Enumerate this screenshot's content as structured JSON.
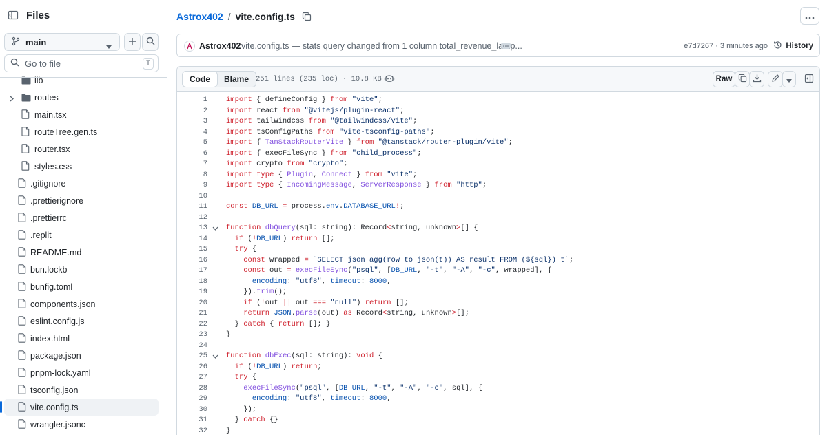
{
  "sidebar": {
    "title": "Files",
    "branch": "main",
    "goto_placeholder": "Go to file",
    "goto_key": "T",
    "tree": [
      {
        "name": "lib",
        "type": "folder",
        "expandable": false,
        "depth": 1
      },
      {
        "name": "routes",
        "type": "folder",
        "expandable": true,
        "depth": 1
      },
      {
        "name": "main.tsx",
        "type": "file",
        "depth": 1
      },
      {
        "name": "routeTree.gen.ts",
        "type": "file",
        "depth": 1
      },
      {
        "name": "router.tsx",
        "type": "file",
        "depth": 1
      },
      {
        "name": "styles.css",
        "type": "file",
        "depth": 1
      },
      {
        "name": ".gitignore",
        "type": "file",
        "depth": 0
      },
      {
        "name": ".prettierignore",
        "type": "file",
        "depth": 0
      },
      {
        "name": ".prettierrc",
        "type": "file",
        "depth": 0
      },
      {
        "name": ".replit",
        "type": "file",
        "depth": 0
      },
      {
        "name": "README.md",
        "type": "file",
        "depth": 0
      },
      {
        "name": "bun.lockb",
        "type": "file",
        "depth": 0
      },
      {
        "name": "bunfig.toml",
        "type": "file",
        "depth": 0
      },
      {
        "name": "components.json",
        "type": "file",
        "depth": 0
      },
      {
        "name": "eslint.config.js",
        "type": "file",
        "depth": 0
      },
      {
        "name": "index.html",
        "type": "file",
        "depth": 0
      },
      {
        "name": "package.json",
        "type": "file",
        "depth": 0
      },
      {
        "name": "pnpm-lock.yaml",
        "type": "file",
        "depth": 0
      },
      {
        "name": "tsconfig.json",
        "type": "file",
        "depth": 0
      },
      {
        "name": "vite.config.ts",
        "type": "file",
        "depth": 0,
        "active": true
      },
      {
        "name": "wrangler.jsonc",
        "type": "file",
        "depth": 0
      }
    ]
  },
  "header": {
    "repo": "Astrox402",
    "separator": "/",
    "file": "vite.config.ts"
  },
  "commit": {
    "author": "Astrox402",
    "message": "vite.config.ts — stats query changed from 1 column total_revenue_lamp...",
    "sha": "e7d7267",
    "time": "3 minutes ago",
    "history_label": "History"
  },
  "file": {
    "tab_code": "Code",
    "tab_blame": "Blame",
    "info": "251 lines (235 loc) · 10.8 KB",
    "raw_label": "Raw"
  },
  "code_lines": [
    {
      "n": "1",
      "fold": false,
      "html": "<span class='kw'>import</span> { defineConfig } <span class='kw'>from</span> <span class='st'>\"vite\"</span>;"
    },
    {
      "n": "2",
      "fold": false,
      "html": "<span class='kw'>import</span> react <span class='kw'>from</span> <span class='st'>\"@vitejs/plugin-react\"</span>;"
    },
    {
      "n": "3",
      "fold": false,
      "html": "<span class='kw'>import</span> tailwindcss <span class='kw'>from</span> <span class='st'>\"@tailwindcss/vite\"</span>;"
    },
    {
      "n": "4",
      "fold": false,
      "html": "<span class='kw'>import</span> tsConfigPaths <span class='kw'>from</span> <span class='st'>\"vite-tsconfig-paths\"</span>;"
    },
    {
      "n": "5",
      "fold": false,
      "html": "<span class='kw'>import</span> { <span class='fn'>TanStackRouterVite</span> } <span class='kw'>from</span> <span class='st'>\"@tanstack/router-plugin/vite\"</span>;"
    },
    {
      "n": "6",
      "fold": false,
      "html": "<span class='kw'>import</span> { execFileSync } <span class='kw'>from</span> <span class='st'>\"child_process\"</span>;"
    },
    {
      "n": "7",
      "fold": false,
      "html": "<span class='kw'>import</span> crypto <span class='kw'>from</span> <span class='st'>\"crypto\"</span>;"
    },
    {
      "n": "8",
      "fold": false,
      "html": "<span class='kw'>import</span> <span class='kw'>type</span> { <span class='fn'>Plugin</span>, <span class='fn'>Connect</span> } <span class='kw'>from</span> <span class='st'>\"vite\"</span>;"
    },
    {
      "n": "9",
      "fold": false,
      "html": "<span class='kw'>import</span> <span class='kw'>type</span> { <span class='fn'>IncomingMessage</span>, <span class='fn'>ServerResponse</span> } <span class='kw'>from</span> <span class='st'>\"http\"</span>;"
    },
    {
      "n": "10",
      "fold": false,
      "html": ""
    },
    {
      "n": "11",
      "fold": false,
      "html": "<span class='kw'>const</span> <span class='id'>DB_URL</span> <span class='kw'>=</span> process.<span class='id'>env</span>.<span class='id'>DATABASE_URL</span><span class='kw'>!</span>;"
    },
    {
      "n": "12",
      "fold": false,
      "html": ""
    },
    {
      "n": "13",
      "fold": true,
      "html": "<span class='kw'>function</span> <span class='fn'>dbQuery</span>(sql: string): Record<span class='kw'>&lt;</span>string, unknown<span class='kw'>&gt;</span>[] {"
    },
    {
      "n": "14",
      "fold": false,
      "html": "  <span class='kw'>if</span> (<span class='kw'>!</span><span class='id'>DB_URL</span>) <span class='kw'>return</span> [];"
    },
    {
      "n": "15",
      "fold": false,
      "html": "  <span class='kw'>try</span> {"
    },
    {
      "n": "16",
      "fold": false,
      "html": "    <span class='kw'>const</span> wrapped <span class='kw'>=</span> <span class='st'>`SELECT json_agg(row_to_json(t)) AS result FROM (${sql}) t`</span>;"
    },
    {
      "n": "17",
      "fold": false,
      "html": "    <span class='kw'>const</span> out <span class='kw'>=</span> <span class='fn'>execFileSync</span>(<span class='st'>\"psql\"</span>, [<span class='id'>DB_URL</span>, <span class='st'>\"-t\"</span>, <span class='st'>\"-A\"</span>, <span class='st'>\"-c\"</span>, wrapped], {"
    },
    {
      "n": "18",
      "fold": false,
      "html": "      <span class='id'>encoding</span>: <span class='st'>\"utf8\"</span>, <span class='id'>timeout</span>: <span class='id'>8000</span>,"
    },
    {
      "n": "19",
      "fold": false,
      "html": "    }).<span class='fn'>trim</span>();"
    },
    {
      "n": "20",
      "fold": false,
      "html": "    <span class='kw'>if</span> (<span class='kw'>!</span>out <span class='kw'>||</span> out <span class='kw'>===</span> <span class='st'>\"null\"</span>) <span class='kw'>return</span> [];"
    },
    {
      "n": "21",
      "fold": false,
      "html": "    <span class='kw'>return</span> <span class='id'>JSON</span>.<span class='fn'>parse</span>(out) <span class='kw'>as</span> Record<span class='kw'>&lt;</span>string, unknown<span class='kw'>&gt;</span>[];"
    },
    {
      "n": "22",
      "fold": false,
      "html": "  } <span class='kw'>catch</span> { <span class='kw'>return</span> []; }"
    },
    {
      "n": "23",
      "fold": false,
      "html": "}"
    },
    {
      "n": "24",
      "fold": false,
      "html": ""
    },
    {
      "n": "25",
      "fold": true,
      "html": "<span class='kw'>function</span> <span class='fn'>dbExec</span>(sql: string): <span class='kw'>void</span> {"
    },
    {
      "n": "26",
      "fold": false,
      "html": "  <span class='kw'>if</span> (<span class='kw'>!</span><span class='id'>DB_URL</span>) <span class='kw'>return</span>;"
    },
    {
      "n": "27",
      "fold": false,
      "html": "  <span class='kw'>try</span> {"
    },
    {
      "n": "28",
      "fold": false,
      "html": "    <span class='fn'>execFileSync</span>(<span class='st'>\"psql\"</span>, [<span class='id'>DB_URL</span>, <span class='st'>\"-t\"</span>, <span class='st'>\"-A\"</span>, <span class='st'>\"-c\"</span>, sql], {"
    },
    {
      "n": "29",
      "fold": false,
      "html": "      <span class='id'>encoding</span>: <span class='st'>\"utf8\"</span>, <span class='id'>timeout</span>: <span class='id'>8000</span>,"
    },
    {
      "n": "30",
      "fold": false,
      "html": "    });"
    },
    {
      "n": "31",
      "fold": false,
      "html": "  } <span class='kw'>catch</span> {}"
    },
    {
      "n": "32",
      "fold": false,
      "html": "}"
    }
  ],
  "colors": {
    "accent": "#0969da",
    "keyword": "#cf222e",
    "string": "#0a3069",
    "function": "#8250df",
    "identifier": "#0550ae"
  },
  "icons": {
    "sidebar_toggle": "sidebar-collapse-icon",
    "branch": "git-branch-icon",
    "add": "plus-icon",
    "search": "search-icon",
    "folder": "folder-icon",
    "file": "file-icon",
    "copy": "copy-icon",
    "kebab": "kebab-horizontal-icon",
    "history": "history-icon",
    "download": "download-icon",
    "edit": "pencil-icon",
    "symbols": "symbols-panel-icon"
  }
}
